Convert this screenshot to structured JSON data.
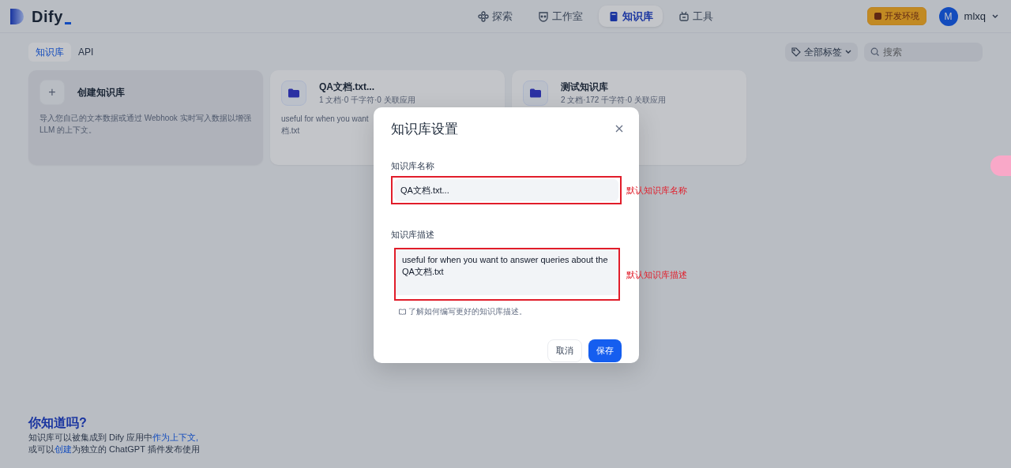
{
  "header": {
    "logo": "Dify",
    "nav": [
      {
        "label": "探索",
        "selected": false
      },
      {
        "label": "工作室",
        "selected": false
      },
      {
        "label": "知识库",
        "selected": true
      },
      {
        "label": "工具",
        "selected": false
      }
    ],
    "env_badge": "开发环境",
    "user": {
      "initial": "M",
      "name": "mlxq"
    }
  },
  "subtabs": [
    {
      "label": "知识库",
      "selected": true
    },
    {
      "label": "API",
      "selected": false
    }
  ],
  "tag_filter": "全部标签",
  "search": {
    "placeholder": "搜索"
  },
  "create_card": {
    "icon": "+",
    "title": "创建知识库",
    "description": "导入您自己的文本数据或通过 Webhook 实时写入数据以增强 LLM 的上下文。"
  },
  "datasets": [
    {
      "name": "QA文档.txt...",
      "meta": "1 文档·0 千字符·0 关联应用",
      "description_lines": [
        "useful for when you want",
        "档.txt"
      ]
    },
    {
      "name": "测试知识库",
      "meta": "2 文档·172 千字符·0 关联应用"
    }
  ],
  "tip": {
    "title": "你知道吗?",
    "lines": [
      [
        {
          "kind": "text",
          "text": "知识库可以被集成到 Dify 应用中"
        },
        {
          "kind": "link",
          "text": "作为上下文,"
        }
      ],
      [
        {
          "kind": "text",
          "text": "或可以"
        },
        {
          "kind": "link",
          "text": "创建"
        },
        {
          "kind": "text",
          "text": "为独立的 ChatGPT 插件发布使用"
        }
      ]
    ]
  },
  "modal": {
    "title": "知识库设置",
    "name_label": "知识库名称",
    "name_value": "QA文档.txt...",
    "desc_label": "知识库描述",
    "desc_value": "useful for when you want to answer queries about the QA文档.txt",
    "help": "了解如何编写更好的知识库描述。",
    "cancel": "取消",
    "save": "保存",
    "annotations": [
      "默认知识库名称",
      "默认知识库描述"
    ]
  }
}
